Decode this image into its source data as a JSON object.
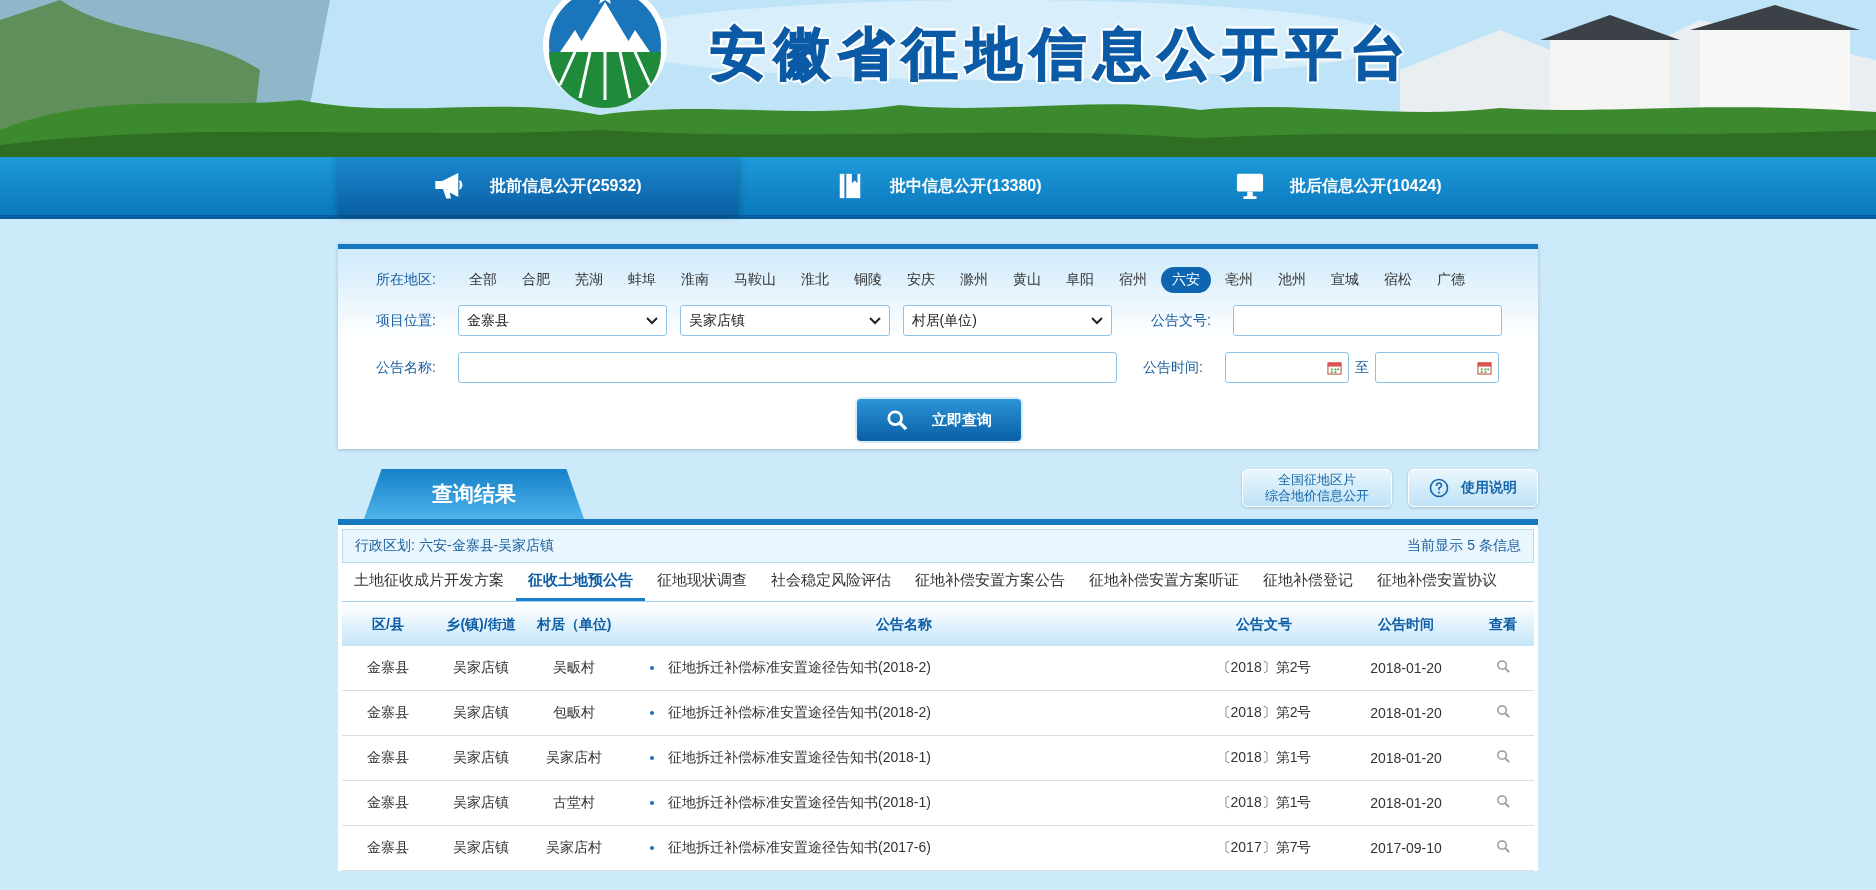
{
  "header": {
    "title": "安徽省征地信息公开平台"
  },
  "nav": [
    {
      "label": "批前信息公开(25932)",
      "selected": true
    },
    {
      "label": "批中信息公开(13380)",
      "selected": false
    },
    {
      "label": "批后信息公开(10424)",
      "selected": false
    }
  ],
  "filters": {
    "region_label": "所在地区:",
    "regions": [
      {
        "label": "全部",
        "selected": false
      },
      {
        "label": "合肥",
        "selected": false
      },
      {
        "label": "芜湖",
        "selected": false
      },
      {
        "label": "蚌埠",
        "selected": false
      },
      {
        "label": "淮南",
        "selected": false
      },
      {
        "label": "马鞍山",
        "selected": false
      },
      {
        "label": "淮北",
        "selected": false
      },
      {
        "label": "铜陵",
        "selected": false
      },
      {
        "label": "安庆",
        "selected": false
      },
      {
        "label": "滁州",
        "selected": false
      },
      {
        "label": "黄山",
        "selected": false
      },
      {
        "label": "阜阳",
        "selected": false
      },
      {
        "label": "宿州",
        "selected": false
      },
      {
        "label": "六安",
        "selected": true
      },
      {
        "label": "亳州",
        "selected": false
      },
      {
        "label": "池州",
        "selected": false
      },
      {
        "label": "宣城",
        "selected": false
      },
      {
        "label": "宿松",
        "selected": false
      },
      {
        "label": "广德",
        "selected": false
      }
    ],
    "location_label": "项目位置:",
    "location_selects": [
      "金寨县",
      "吴家店镇",
      "村居(单位)"
    ],
    "doc_no_label": "公告文号:",
    "name_label": "公告名称:",
    "time_label": "公告时间:",
    "time_separator": "至",
    "search_button": "立即查询"
  },
  "results": {
    "title": "查询结果",
    "price_button": [
      "全国征地区片",
      "综合地价信息公开"
    ],
    "help_button": "使用说明",
    "breadcrumb_label": "行政区划:",
    "breadcrumb": "六安-金寨县-吴家店镇",
    "count": "当前显示 5 条信息",
    "tabs": [
      {
        "label": "土地征收成片开发方案",
        "selected": false
      },
      {
        "label": "征收土地预公告",
        "selected": true
      },
      {
        "label": "征地现状调查",
        "selected": false
      },
      {
        "label": "社会稳定风险评估",
        "selected": false
      },
      {
        "label": "征地补偿安置方案公告",
        "selected": false
      },
      {
        "label": "征地补偿安置方案听证",
        "selected": false
      },
      {
        "label": "征地补偿登记",
        "selected": false
      },
      {
        "label": "征地补偿安置协议",
        "selected": false
      }
    ],
    "table": {
      "columns": [
        "区/县",
        "乡(镇)/街道",
        "村居（单位)",
        "公告名称",
        "公告文号",
        "公告时间",
        "查看"
      ],
      "rows": [
        [
          "金寨县",
          "吴家店镇",
          "吴畈村",
          "征地拆迁补偿标准安置途径告知书(2018-2)",
          "〔2018〕第2号",
          "2018-01-20"
        ],
        [
          "金寨县",
          "吴家店镇",
          "包畈村",
          "征地拆迁补偿标准安置途径告知书(2018-2)",
          "〔2018〕第2号",
          "2018-01-20"
        ],
        [
          "金寨县",
          "吴家店镇",
          "吴家店村",
          "征地拆迁补偿标准安置途径告知书(2018-1)",
          "〔2018〕第1号",
          "2018-01-20"
        ],
        [
          "金寨县",
          "吴家店镇",
          "古堂村",
          "征地拆迁补偿标准安置途径告知书(2018-1)",
          "〔2018〕第1号",
          "2018-01-20"
        ],
        [
          "金寨县",
          "吴家店镇",
          "吴家店村",
          "征地拆迁补偿标准安置途径告知书(2017-6)",
          "〔2017〕第7号",
          "2017-09-10"
        ]
      ]
    }
  }
}
